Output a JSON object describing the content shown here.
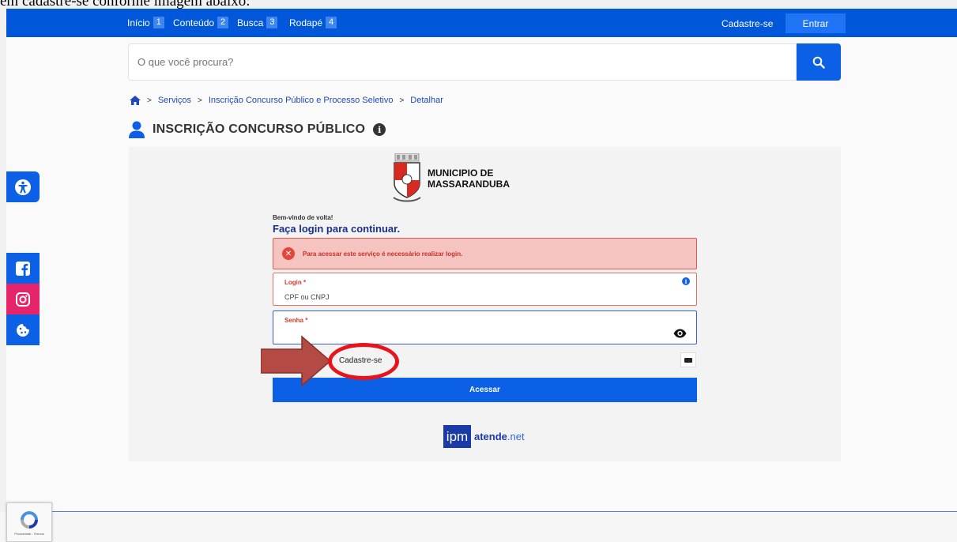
{
  "document": {
    "caption": "em cadastre-se conforme imagem abaixo:"
  },
  "topbar": {
    "skip_links": [
      {
        "label": "Início",
        "num": "1"
      },
      {
        "label": "Conteúdo",
        "num": "2"
      },
      {
        "label": "Busca",
        "num": "3"
      },
      {
        "label": "Rodapé",
        "num": "4"
      }
    ],
    "signup_label": "Cadastre-se",
    "login_label": "Entrar"
  },
  "search": {
    "placeholder": "O que você procura?"
  },
  "breadcrumb": {
    "items": [
      "Serviços",
      "Inscrição Concurso Público e Processo Seletivo",
      "Detalhar"
    ]
  },
  "page": {
    "title": "INSCRIÇÃO CONCURSO PÚBLICO",
    "info_glyph": "i"
  },
  "municipality": {
    "line1": "MUNICIPIO DE",
    "line2": "MASSARANDUBA"
  },
  "login_form": {
    "welcome": "Bem-vindo de volta!",
    "heading": "Faça login para continuar.",
    "alert_text": "Para acessar este serviço é necessário realizar login.",
    "login_label": "Login *",
    "login_value": "CPF ou CNPJ",
    "password_label": "Senha *",
    "signup_link": "Cadastre-se",
    "submit_label": "Acessar"
  },
  "brand": {
    "ipm": "ipm",
    "atende": "atende",
    "net": ".net"
  },
  "recaptcha": {
    "text": "Privacidade - Termos"
  },
  "colors": {
    "primary": "#0057d9",
    "button": "#0b60e6",
    "alert_bg": "#f5c4c0",
    "alert_border": "#e25a4f",
    "highlight_red": "#e8141b",
    "arrow": "#b34a44",
    "instagram": "#e5246a"
  },
  "icons": {
    "search": "search-icon",
    "home": "home-icon",
    "user": "user-icon",
    "accessibility": "accessibility-icon",
    "facebook": "facebook-icon",
    "instagram": "instagram-icon",
    "cookie": "cookie-icon",
    "eye": "eye-icon",
    "card": "credit-card-icon"
  }
}
